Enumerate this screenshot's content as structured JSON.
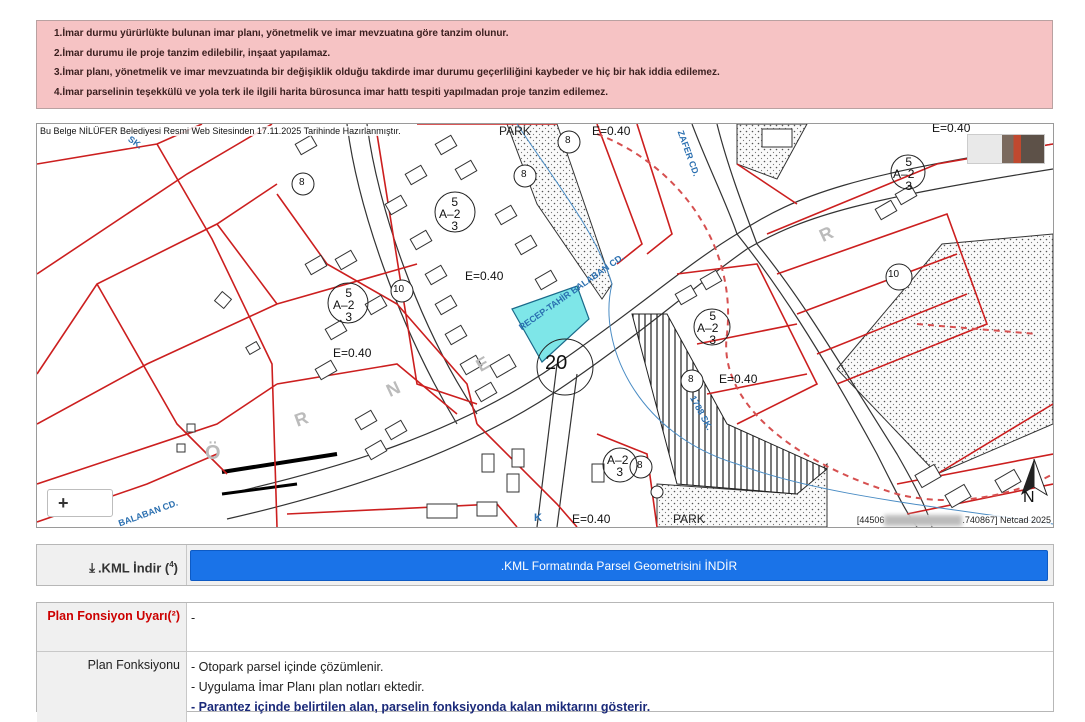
{
  "notices": [
    "1.İmar durmu yürürlükte bulunan imar planı, yönetmelik ve imar mevzuatına göre tanzim olunur.",
    "2.İmar durumu ile proje tanzim edilebilir, inşaat yapılamaz.",
    "3.İmar planı, yönetmelik ve imar mevzuatında bir değişiklik olduğu takdirde imar durumu geçerliliğini kaybeder ve hiç bir hak iddia edilemez.",
    "4.İmar parselinin teşekkülü ve yola terk ile ilgili harita bürosunca imar hattı tespiti yapılmadan proje tanzim edilemez."
  ],
  "map": {
    "caption": "Bu Belge NİLÜFER Belediyesi Resmi Web Sitesinden 17.11.2025 Tarihinde Hazırlanmıştır.",
    "zoom_label": "+",
    "coords_left": "[44506",
    "coords_right": ".740867] Netcad 2025",
    "north": "N",
    "labels": {
      "park_top": "PARK",
      "park_bottom": "PARK",
      "e040": "E=0.40",
      "road_main": "RECEP-TAHİR BALABAN CD.",
      "road_diag": "1788 SK.",
      "road_top": "SK.",
      "road_cd": "ZAFER CD.",
      "road_bottom_left": "BALABAN CD.",
      "road_k": "K",
      "zone_r": "R",
      "zone_n": "N",
      "zone_e": "E",
      "zone_o": "Ö",
      "zone_p": "R",
      "a32": "A",
      "frac_top": "5",
      "frac_bottom": "3",
      "frac_mid": "2",
      "frac_a2": "2",
      "circle_8": "8",
      "circle_10": "10",
      "circle_20": "20"
    }
  },
  "kml": {
    "label": ".KML İndir (",
    "label_sup": "4",
    "label_end": ")",
    "button": ".KML Formatında Parsel Geometrisini İNDİR"
  },
  "info": {
    "warn_key": "Plan Fonsiyon Uyarı(²)",
    "warn_val": "-",
    "func_key": "Plan Fonksiyonu",
    "func_lines": [
      "- Otopark parsel içinde çözümlenir.",
      "- Uygulama İmar Planı plan notları ektedir."
    ],
    "func_bold": "- Parantez içinde belirtilen alan, parselin fonksiyonda kalan miktarını gösterir."
  },
  "colors": {
    "notice_bg": "#f6c3c4",
    "parcel_line": "#cc1f1f",
    "highlight_parcel": "#7ee6e8",
    "button_blue": "#1a73e8",
    "warn_red": "#cc0000"
  }
}
